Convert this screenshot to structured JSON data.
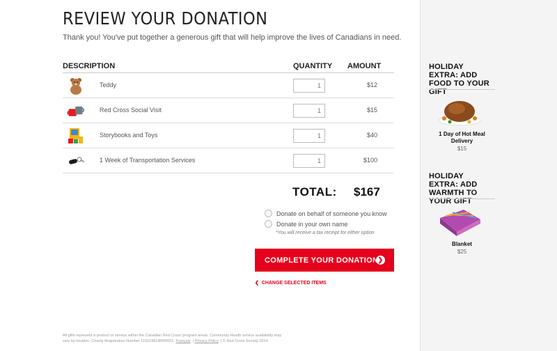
{
  "page": {
    "title": "REVIEW YOUR DONATION",
    "subtitle": "Thank you! You've put together a generous gift that will help improve the lives of Canadians in need."
  },
  "table": {
    "headers": {
      "description": "DESCRIPTION",
      "quantity": "QUANTITY",
      "amount": "AMOUNT"
    },
    "rows": [
      {
        "icon": "teddy-bear-icon",
        "description": "Teddy",
        "quantity": "1",
        "amount": "$12"
      },
      {
        "icon": "mugs-icon",
        "description": "Red Cross Social Visit",
        "quantity": "1",
        "amount": "$15"
      },
      {
        "icon": "storybooks-icon",
        "description": "Storybooks and Toys",
        "quantity": "1",
        "amount": "$40"
      },
      {
        "icon": "car-keys-icon",
        "description": "1 Week of Transportation Services",
        "quantity": "1",
        "amount": "$100"
      }
    ]
  },
  "total": {
    "label": "TOTAL:",
    "value": "$167"
  },
  "donor_options": [
    "Donate on behalf of someone you know",
    "Donate in your own name"
  ],
  "tax_note": "*You will receive a tax receipt for either option",
  "cta": {
    "label": "COMPLETE YOUR DONATION"
  },
  "change_link": "CHANGE SELECTED ITEMS",
  "footer": {
    "text1": "All gifts represent a product or service within the Canadian Red Cross' program areas. Community Health service availability may",
    "text2": "vary by location. Charity Registration Number 119219814RR0001",
    "francais": "Français",
    "privacy": "Privacy Policy",
    "copyright": "© Red Cross Society 2014"
  },
  "sidebar": {
    "extras": [
      {
        "heading": "HOLIDAY EXTRA: ADD FOOD TO YOUR GIFT",
        "name": "1 Day of Hot Meal Delivery",
        "price": "$15",
        "icon": "roast-turkey-icon"
      },
      {
        "heading": "HOLIDAY EXTRA: ADD WARMTH TO YOUR GIFT",
        "name": "Blanket",
        "price": "$25",
        "icon": "blanket-icon"
      }
    ]
  },
  "colors": {
    "accent": "#e5001b",
    "sidebar_bg": "#f4f4f4"
  }
}
